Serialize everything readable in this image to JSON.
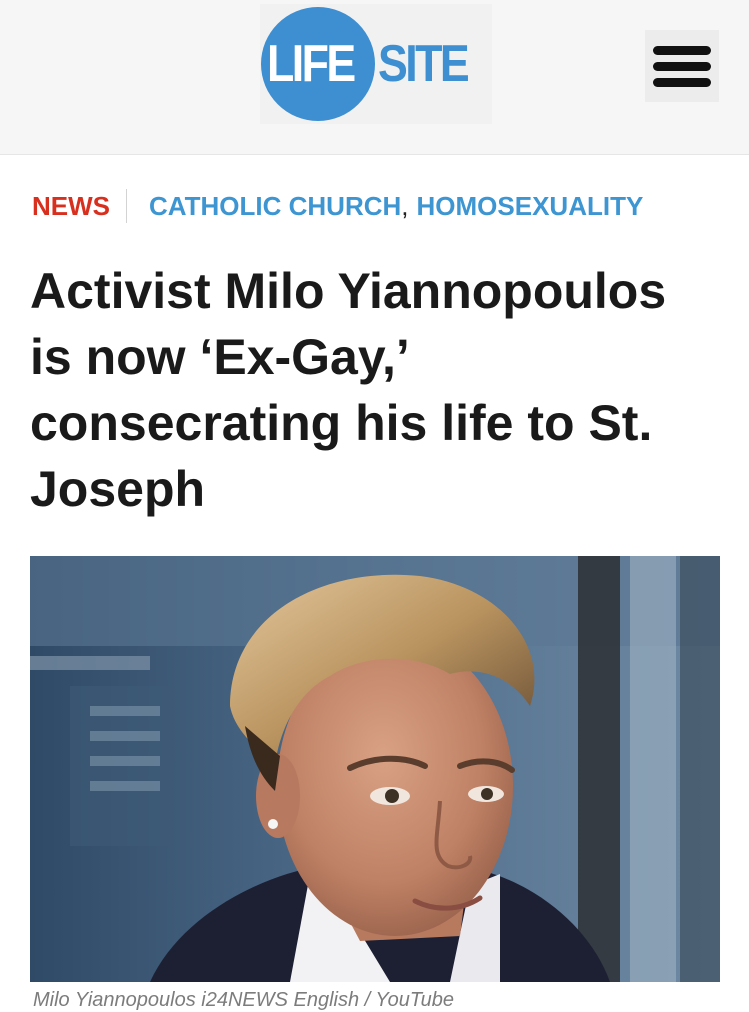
{
  "header": {
    "logo": {
      "part1": "LIFE",
      "part2": "SITE",
      "circle_color": "#3d8fd1",
      "text_color": "#3d8fd1"
    },
    "menu_icon": "hamburger-menu-icon"
  },
  "categories": {
    "section": "NEWS",
    "section_color": "#d8301f",
    "tags": [
      {
        "label": "CATHOLIC CHURCH"
      },
      {
        "label": "HOMOSEXUALITY"
      }
    ],
    "tag_separator": ",",
    "tag_color": "#3d95d2"
  },
  "article": {
    "title": "Activist Milo Yiannopoulos is now ‘Ex-Gay,’ consecrating his life to St. Joseph",
    "image_caption": "Milo Yiannopoulos i24NEWS English / YouTube"
  }
}
